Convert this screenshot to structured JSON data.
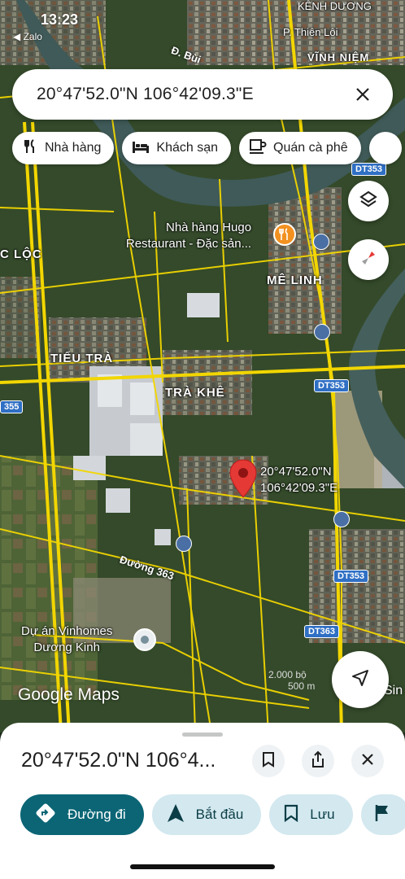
{
  "status": {
    "time": "13:23",
    "back_app": "◀ Zalo"
  },
  "search": {
    "value": "20°47'52.0\"N 106°42'09.3\"E"
  },
  "chips": [
    {
      "label": "Nhà hàng",
      "icon": "fork-knife-icon"
    },
    {
      "label": "Khách sạn",
      "icon": "bed-icon"
    },
    {
      "label": "Quán cà phê",
      "icon": "coffee-cup-icon"
    }
  ],
  "map": {
    "labels": {
      "kenh_duong": "KÊNH DƯƠNG",
      "vinh_niem": "VĨNH NIỆM",
      "thien_loi": "P. Thiên Lôi",
      "c_loc": "C LỘC",
      "me_linh": "MÊ LINH",
      "tieu_tra": "TIỂU TRÀ",
      "tra_khe": "TRÀ KHÊ"
    },
    "poi": {
      "line1": "Nhà hàng Hugo",
      "line2": "Restaurant - Đặc sản..."
    },
    "roads": {
      "duong_363": "Đường 363",
      "b_bui": "Đ. Bùi"
    },
    "shields": {
      "dt353": "DT353",
      "dt363": "DT363",
      "s355": "355"
    },
    "pin": {
      "lat": "20°47'52.0\"N",
      "lng": "106°42'09.3\"E"
    },
    "project": {
      "line1": "Dự án Vinhomes",
      "line2": "Dương Kinh"
    },
    "logo": "Google Maps",
    "scale": "2.000 bộ",
    "scale2": "500 m",
    "sin": "Sin"
  },
  "sheet": {
    "title": "20°47'52.0\"N 106°4...",
    "actions": [
      {
        "label": "Đường đi",
        "icon": "directions-icon"
      },
      {
        "label": "Bắt đầu",
        "icon": "navigation-arrow-icon"
      },
      {
        "label": "Lưu",
        "icon": "bookmark-icon"
      }
    ]
  },
  "colors": {
    "accent": "#0b6575",
    "chip_bg": "#d3e8ef",
    "pin": "#e53935",
    "road": "#f2d600"
  }
}
